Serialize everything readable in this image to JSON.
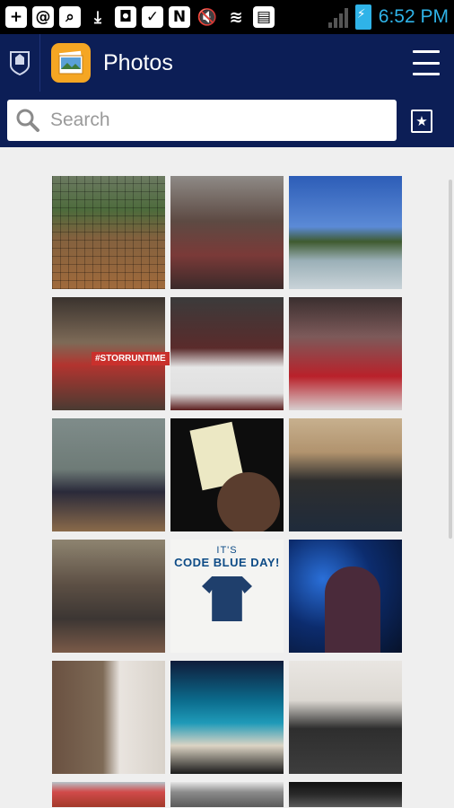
{
  "status_bar": {
    "time": "6:52 PM",
    "icons": [
      "add-icon",
      "at-icon",
      "search-square-icon",
      "download-icon",
      "camera-upload-icon",
      "mail-check-icon",
      "nfc-icon",
      "mute-icon",
      "wifi-icon",
      "sim-error-icon",
      "signal-icon",
      "battery-charging-icon"
    ]
  },
  "app_bar": {
    "title": "Photos",
    "logo_icon": "university-crest-icon",
    "app_icon": "photos-app-icon",
    "menu_icon": "hamburger-menu-icon"
  },
  "search": {
    "placeholder": "Search",
    "icon": "search-icon",
    "favorites_icon": "bookmark-star-icon"
  },
  "photos": [
    {
      "id": "photo-1",
      "subject": "baseball"
    },
    {
      "id": "photo-2",
      "subject": "atrium-crowd"
    },
    {
      "id": "photo-3",
      "subject": "fountain"
    },
    {
      "id": "photo-4",
      "subject": "arena-sign",
      "caption": "#STORRUNTIME"
    },
    {
      "id": "photo-5",
      "subject": "check-presentation"
    },
    {
      "id": "photo-6",
      "subject": "court-ceremony"
    },
    {
      "id": "photo-7",
      "subject": "group-photo"
    },
    {
      "id": "photo-8",
      "subject": "held-sign"
    },
    {
      "id": "photo-9",
      "subject": "runners"
    },
    {
      "id": "photo-10",
      "subject": "cafeteria-crowd"
    },
    {
      "id": "photo-11",
      "subject": "code-blue-shirt",
      "line1": "IT'S",
      "line2": "CODE BLUE DAY!"
    },
    {
      "id": "photo-12",
      "subject": "singer"
    },
    {
      "id": "photo-13",
      "subject": "tree-hall"
    },
    {
      "id": "photo-14",
      "subject": "stage-dance"
    },
    {
      "id": "photo-15",
      "subject": "costume-group"
    },
    {
      "id": "photo-16",
      "subject": "partial-1"
    },
    {
      "id": "photo-17",
      "subject": "partial-2"
    },
    {
      "id": "photo-18",
      "subject": "partial-3"
    }
  ],
  "colors": {
    "app_bar": "#0c1e56",
    "status_accent": "#2fb3e8",
    "background": "#efefef",
    "photos_icon": "#f5a623"
  }
}
